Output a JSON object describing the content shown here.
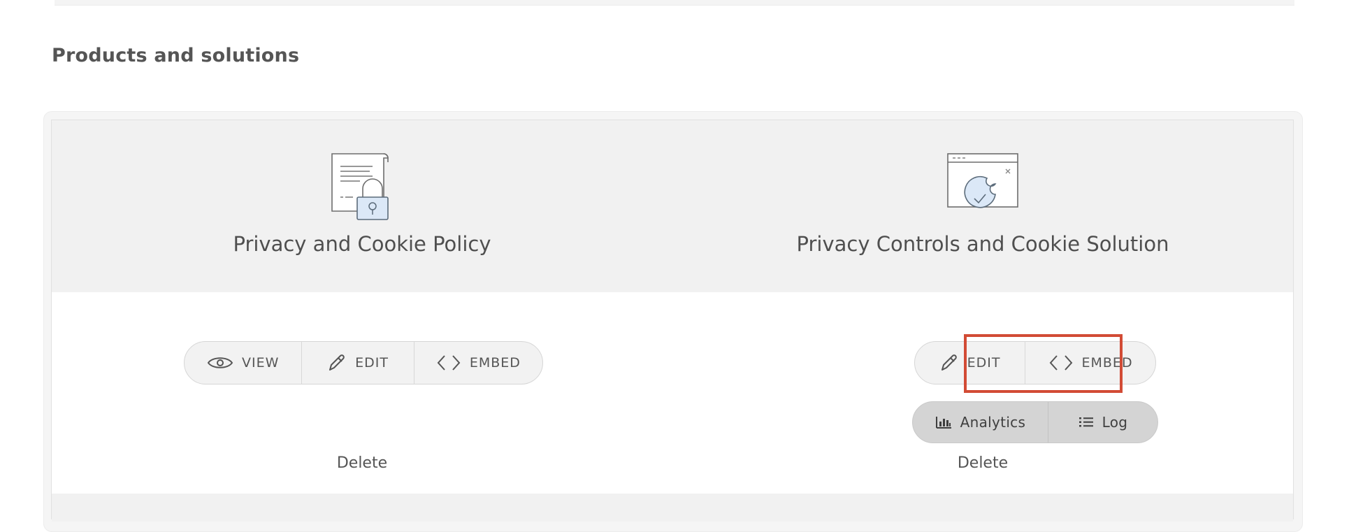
{
  "section": {
    "title": "Products and solutions"
  },
  "products": [
    {
      "title": "Privacy and Cookie Policy",
      "icon": "privacy-policy-lock-icon",
      "actions": [
        {
          "label": "VIEW",
          "icon": "eye-icon"
        },
        {
          "label": "EDIT",
          "icon": "pencil-icon"
        },
        {
          "label": "EMBED",
          "icon": "code-icon"
        }
      ],
      "delete_label": "Delete"
    },
    {
      "title": "Privacy Controls and Cookie Solution",
      "icon": "cookie-browser-icon",
      "actions": [
        {
          "label": "EDIT",
          "icon": "pencil-icon"
        },
        {
          "label": "EMBED",
          "icon": "code-icon"
        }
      ],
      "secondary_actions": [
        {
          "label": "Analytics",
          "icon": "bar-chart-icon"
        },
        {
          "label": "Log",
          "icon": "list-icon"
        }
      ],
      "delete_label": "Delete"
    }
  ],
  "colors": {
    "highlight": "#d24b35",
    "panel_bg": "#f1f1f1",
    "icon_fill": "#dbe8f7",
    "icon_stroke": "#5b6b7a"
  }
}
